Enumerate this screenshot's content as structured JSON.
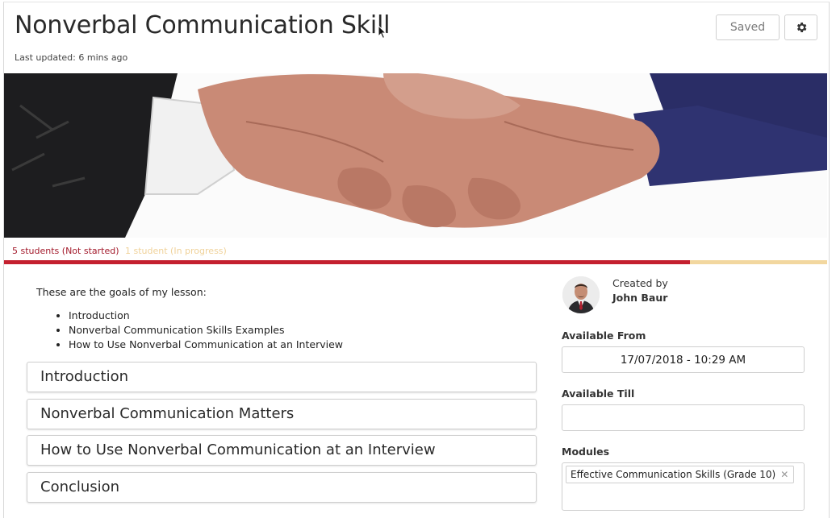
{
  "header": {
    "title": "Nonverbal Communication Skill",
    "last_updated": "Last updated: 6 mins ago",
    "saved_label": "Saved",
    "settings_icon": "gear-icon"
  },
  "hero": {
    "image": "handshake-photo"
  },
  "progress": {
    "not_started_text": "5 students (Not started)",
    "in_progress_text": "1 student (In progress)",
    "not_started_count": 5,
    "in_progress_count": 1,
    "colors": {
      "not_started": "#c4202f",
      "in_progress": "#f2d79f"
    }
  },
  "lesson": {
    "intro": "These are the goals of my lesson:",
    "goals": [
      "Introduction",
      "Nonverbal Communication Skills Examples",
      "How to Use Nonverbal Communication at an Interview"
    ],
    "sections": [
      "Introduction",
      "Nonverbal Communication Matters",
      "How to Use Nonverbal Communication at an Interview",
      "Conclusion"
    ]
  },
  "sidebar": {
    "created_by_label": "Created by",
    "author": "John Baur",
    "available_from_label": "Available From",
    "available_from_value": "17/07/2018 - 10:29 AM",
    "available_till_label": "Available Till",
    "available_till_value": "",
    "modules_label": "Modules",
    "modules": [
      "Effective Communication Skills (Grade 10)"
    ]
  }
}
